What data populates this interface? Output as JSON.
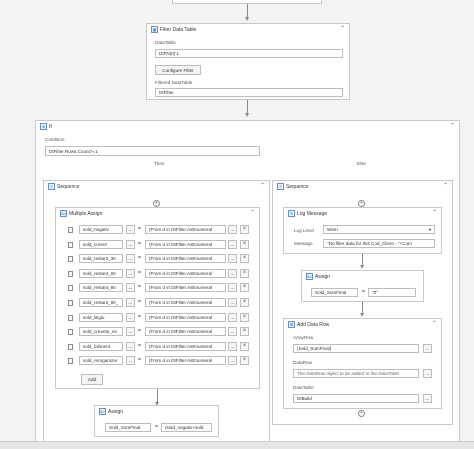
{
  "filter_activity": {
    "title": "Filter Data Table",
    "datatable_label": "DataTable",
    "datatable_value": "DtFN(0)'1",
    "configure_button": "Configure Filter",
    "filtered_label": "Filtered DataTable",
    "filtered_value": "DtFilter"
  },
  "if_activity": {
    "title": "If",
    "condition_label": "Condition",
    "condition_value": "DtFilter.Rows.Count>=1",
    "then_label": "Then",
    "else_label": "Else"
  },
  "then_sequence": {
    "title": "Sequence",
    "multiple_assign": {
      "title": "Multiple Assign",
      "rows": [
        {
          "to": "sold_negativ",
          "value": "(From d in DtFilter.AsEnumeral"
        },
        {
          "to": "sold_curent",
          "value": "(From d in DtFilter.AsEnumeral"
        },
        {
          "to": "sold_restant_30",
          "value": "(From d in DtFilter.AsEnumeral"
        },
        {
          "to": "sold_restant_60",
          "value": "(From d in DtFilter.AsEnumeral"
        },
        {
          "to": "sold_restant_90",
          "value": "(From d in DtFilter.AsEnumeral"
        },
        {
          "to": "sold_restant_90_",
          "value": "(From d in DtFilter.AsEnumeral"
        },
        {
          "to": "sold_litigiu",
          "value": "(From d in DtFilter.AsEnumeral"
        },
        {
          "to": "sold_creante_ne",
          "value": "(From d in DtFilter.AsEnumeral"
        },
        {
          "to": "sold_faliment",
          "value": "(From d in DtFilter.AsEnumeral"
        },
        {
          "to": "sold_reorganizar",
          "value": "(From d in DtFilter.AsEnumeral"
        }
      ],
      "add_button": "Add",
      "more_button": "...",
      "equals": "="
    },
    "assign": {
      "title": "Assign",
      "to": "Sold_SumFinal",
      "equals": "=",
      "value": "(sold_negativ+sold"
    }
  },
  "else_sequence": {
    "title": "Sequence",
    "log_message": {
      "title": "Log Message",
      "level_label": "Log Level",
      "level_value": "Warn",
      "message_label": "Message",
      "message_value": "\"No filter data for this Cod_Client - \"+Cum"
    },
    "assign": {
      "title": "Assign",
      "to": "Sold_SumFinal",
      "equals": "=",
      "value": "\"0\""
    },
    "add_data_row": {
      "title": "Add Data Row",
      "arrayrow_label": "ArrayRow",
      "arrayrow_value": "{Sold_SumFinal}",
      "datarow_label": "DataRow",
      "datarow_placeholder": "The DataRow object to be added to the DataTable.",
      "datatable_label": "DataTable",
      "datatable_value": "DtBuild"
    }
  },
  "icons": {
    "collapse": "collapse-chevron-icon",
    "filter": "filter-table-icon",
    "if": "if-icon",
    "sequence": "sequence-icon",
    "assign": "assign-icon",
    "log": "log-message-icon",
    "add_row": "add-data-row-icon"
  }
}
